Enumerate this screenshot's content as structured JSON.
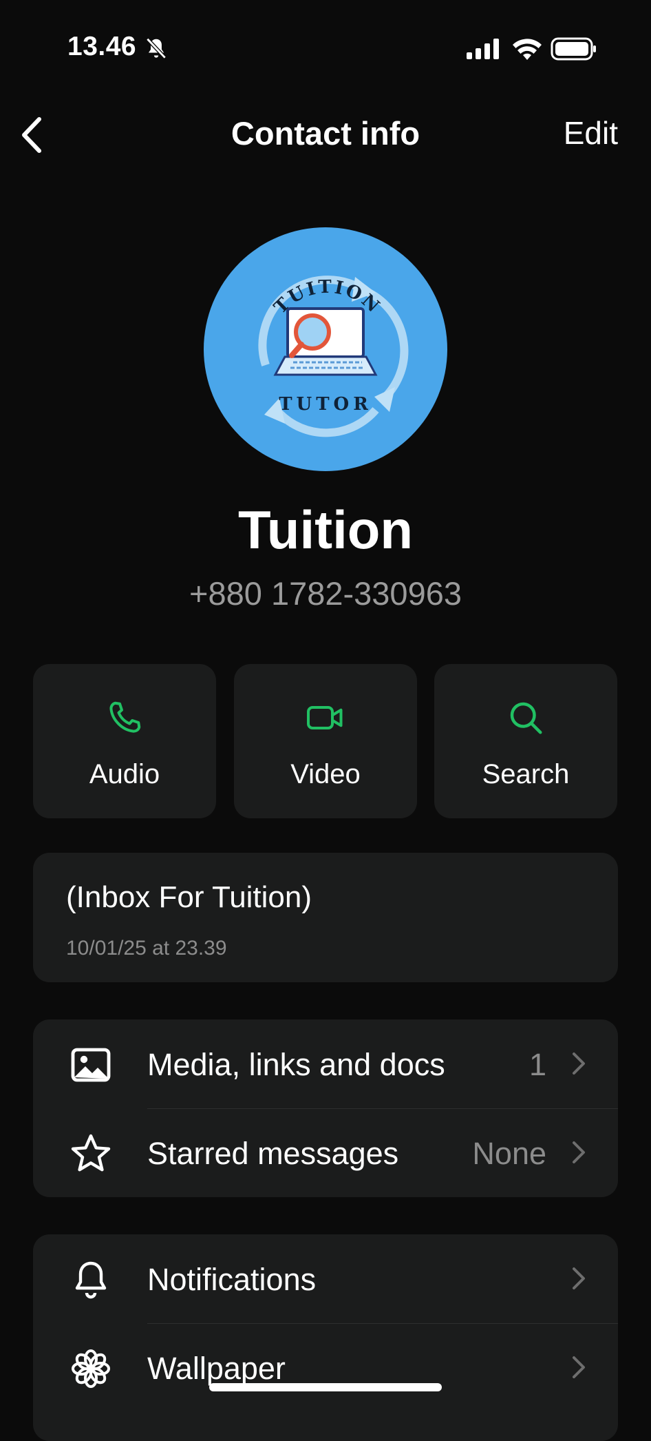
{
  "status_bar": {
    "time": "13.46",
    "icons": [
      "bell-slash-icon",
      "signal-icon",
      "wifi-icon",
      "battery-icon"
    ]
  },
  "nav": {
    "title": "Contact info",
    "edit_label": "Edit",
    "back_icon": "chevron-left-icon"
  },
  "avatar": {
    "text_top": "TUITION",
    "text_bottom": "TUTOR",
    "background": "#4aa6ea"
  },
  "contact": {
    "name": "Tuition",
    "phone": "+880 1782-330963"
  },
  "actions": [
    {
      "label": "Audio",
      "icon": "phone-icon"
    },
    {
      "label": "Video",
      "icon": "video-camera-icon"
    },
    {
      "label": "Search",
      "icon": "search-icon"
    }
  ],
  "note": {
    "title": "(Inbox For Tuition)",
    "date": "10/01/25 at 23.39"
  },
  "media_group": [
    {
      "label": "Media, links and docs",
      "value": "1",
      "icon": "image-icon"
    },
    {
      "label": "Starred messages",
      "value": "None",
      "icon": "star-icon"
    }
  ],
  "settings_group": [
    {
      "label": "Notifications",
      "icon": "bell-icon"
    },
    {
      "label": "Wallpaper",
      "icon": "flower-icon"
    }
  ],
  "colors": {
    "background": "#0b0b0b",
    "card": "#1b1c1c",
    "accent_green": "#21c063",
    "secondary_text": "#8c8c8c"
  }
}
